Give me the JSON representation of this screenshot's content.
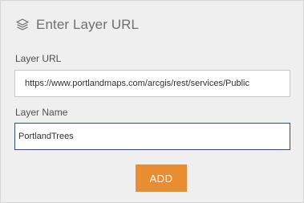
{
  "dialog": {
    "title": "Enter Layer URL",
    "title_icon": "layers-icon"
  },
  "fields": {
    "layer_url": {
      "label": "Layer URL",
      "value": "https://www.portlandmaps.com/arcgis/rest/services/Public"
    },
    "layer_name": {
      "label": "Layer Name",
      "value": "PortlandTrees"
    }
  },
  "actions": {
    "add_label": "ADD"
  },
  "colors": {
    "panel_background": "#efefef",
    "add_button": "#e98d32",
    "focused_border": "#324d75"
  }
}
